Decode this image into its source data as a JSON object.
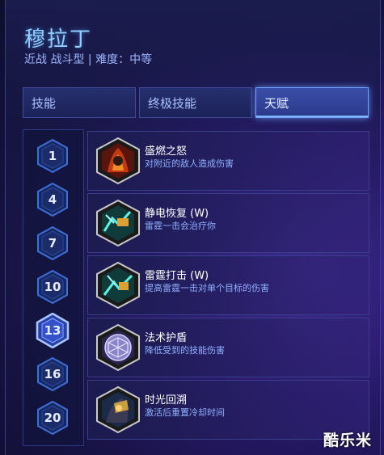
{
  "hero": {
    "name": "穆拉丁",
    "subtitle": "近战 战斗型 | 难度：中等"
  },
  "tabs": [
    {
      "label": "技能",
      "active": false
    },
    {
      "label": "终极技能",
      "active": false
    },
    {
      "label": "天赋",
      "active": true
    }
  ],
  "levels": [
    {
      "label": "1",
      "selected": false
    },
    {
      "label": "4",
      "selected": false
    },
    {
      "label": "7",
      "selected": false
    },
    {
      "label": "10",
      "selected": false
    },
    {
      "label": "13",
      "selected": true
    },
    {
      "label": "16",
      "selected": false
    },
    {
      "label": "20",
      "selected": false
    }
  ],
  "talents": [
    {
      "name": "盛燃之怒",
      "desc": "对附近的敌人造成伤害",
      "icon": "flame-fury-icon"
    },
    {
      "name": "静电恢复 (W)",
      "desc": "雷霆一击会治疗你",
      "icon": "static-recovery-icon"
    },
    {
      "name": "雷霆打击 (W)",
      "desc": "提高雷霆一击对单个目标的伤害",
      "icon": "thunder-strike-icon"
    },
    {
      "name": "法术护盾",
      "desc": "降低受到的技能伤害",
      "icon": "spell-shield-icon"
    },
    {
      "name": "时光回溯",
      "desc": "激活后重置冷却时间",
      "icon": "rewind-icon"
    }
  ],
  "watermark": "酷乐米",
  "colors": {
    "accent": "#6ea3ff",
    "title": "#8fd0ff",
    "desc": "#8fb2ff"
  }
}
